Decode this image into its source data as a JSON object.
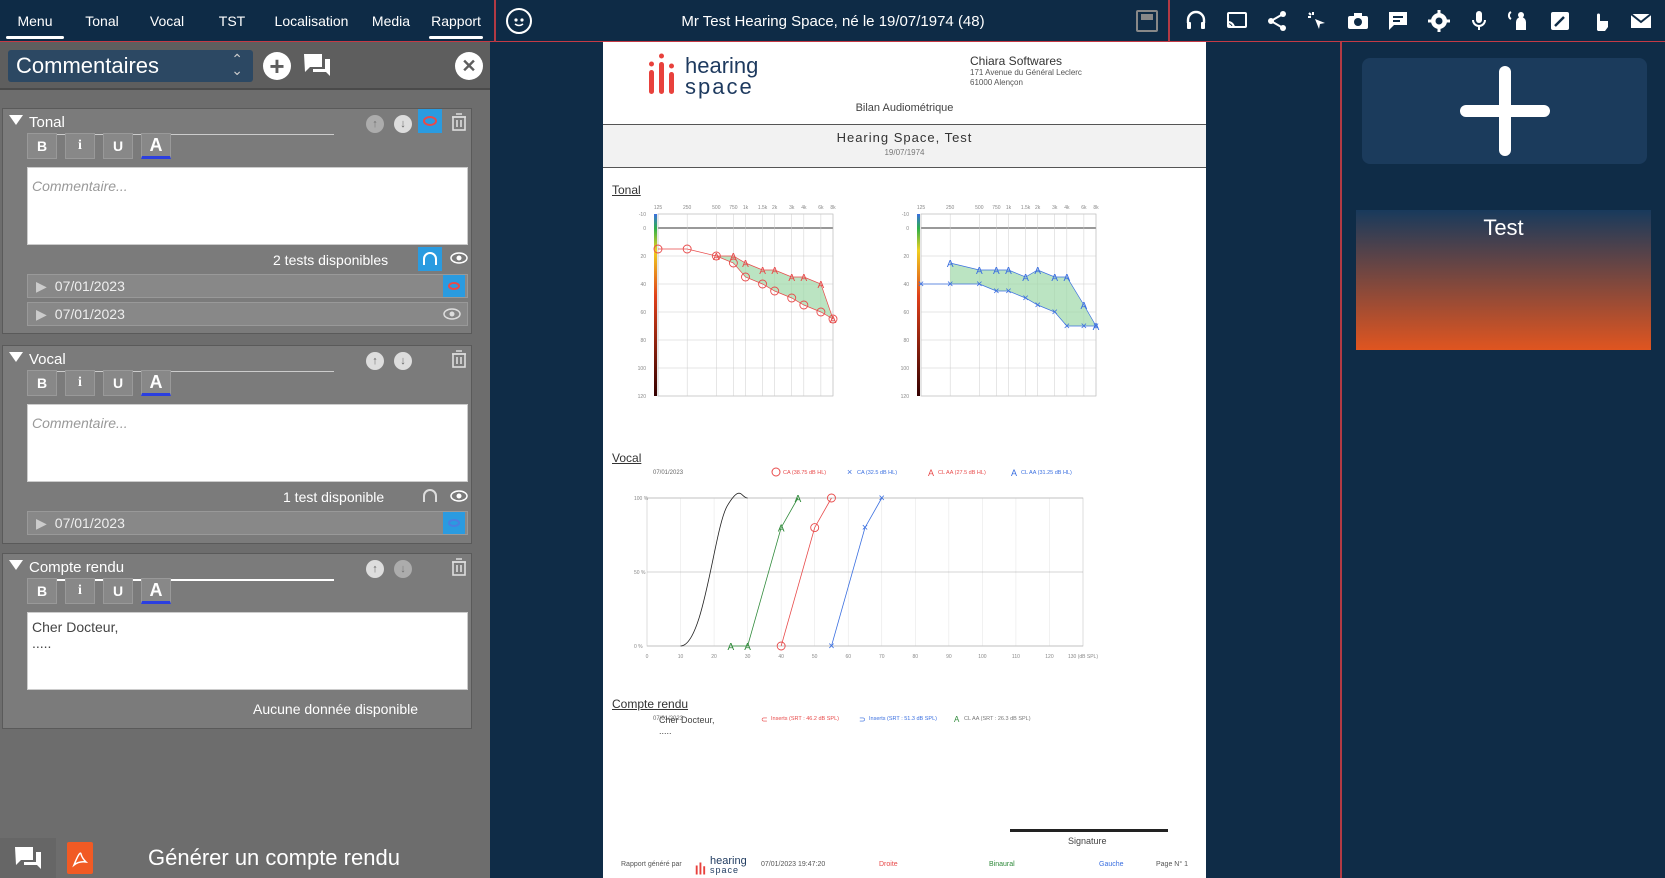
{
  "menu_tabs": [
    "Menu",
    "Tonal",
    "Vocal",
    "TST",
    "Localisation",
    "Media",
    "Rapport"
  ],
  "patient_title": "Mr Test Hearing Space, né le 19/07/1974 (48)",
  "left_panel": {
    "selector_label": "Commentaires",
    "sections": {
      "tonal": {
        "title": "Tonal",
        "placeholder": "Commentaire...",
        "tests_available": "2 tests disponibles",
        "dates": [
          "07/01/2023",
          "07/01/2023"
        ]
      },
      "vocal": {
        "title": "Vocal",
        "placeholder": "Commentaire...",
        "tests_available": "1 test disponible",
        "dates": [
          "07/01/2023"
        ]
      },
      "compte_rendu": {
        "title": "Compte rendu",
        "text_line1": "Cher Docteur,",
        "text_line2": ".....",
        "no_data": "Aucune donnée disponible"
      }
    },
    "format_buttons": {
      "bold": "B",
      "italic": "i",
      "underline": "U",
      "color": "A"
    },
    "generate_label": "Générer un compte rendu"
  },
  "report": {
    "brand_top": "hearing",
    "brand_bottom": "space",
    "company": "Chiara Softwares",
    "address1": "171 Avenue du Général Leclerc",
    "address2": "61000 Alençon",
    "report_title": "Bilan Audiométrique",
    "patient_name": "Hearing Space, Test",
    "patient_dob": "19/07/1974",
    "section_tonal": "Tonal",
    "section_vocal": "Vocal",
    "section_compte": "Compte rendu",
    "compte_line1": "Cher Docteur,",
    "compte_line2": ".....",
    "signature": "Signature",
    "footer_gen": "Rapport généré par",
    "footer_date": "07/01/2023 19:47:20",
    "footer_droite": "Droite",
    "footer_binaural": "Binaural",
    "footer_gauche": "Gauche",
    "footer_page": "Page N° 1",
    "tonal_legend_date": "07/01/2023",
    "tonal_legend": [
      "CA (38.75 dB HL)",
      "CA (32.5 dB HL)",
      "CL AA (27.5 dB HL)",
      "CL AA (31.25 dB HL)"
    ],
    "vocal_legend_date": "07/01/2023",
    "vocal_legend": [
      "Inserts (SRT : 46.2 dB SPL)",
      "Inserts (SRT : 51.3 dB SPL)",
      "CL AA (SRT : 26.3 dB SPL)"
    ]
  },
  "right_panel": {
    "add_label": "+",
    "card_label": "Test"
  },
  "colors": {
    "accent_red": "#c43a45",
    "right_ear": "#e84a4a",
    "left_ear": "#3a6fe0",
    "cl": "#2f8a3a",
    "card_top": "#183a5c",
    "card_bottom": "#e05520"
  },
  "chart_data": [
    {
      "type": "line",
      "title": "",
      "xlabel": "",
      "ylabel": "",
      "x": [
        125,
        250,
        500,
        750,
        1000,
        1500,
        2000,
        3000,
        4000,
        6000,
        8000
      ],
      "ylim": [
        -10,
        120
      ],
      "series": [
        {
          "name": "CA (38.75 dB HL)",
          "values": [
            15,
            15,
            20,
            25,
            35,
            40,
            45,
            50,
            55,
            60,
            65
          ]
        },
        {
          "name": "CL AA (27.5 dB HL)",
          "values": [
            null,
            null,
            20,
            20,
            25,
            30,
            30,
            35,
            35,
            40,
            65
          ]
        }
      ]
    },
    {
      "type": "line",
      "title": "",
      "xlabel": "",
      "ylabel": "",
      "x": [
        125,
        250,
        500,
        750,
        1000,
        1500,
        2000,
        3000,
        4000,
        6000,
        8000
      ],
      "ylim": [
        -10,
        120
      ],
      "series": [
        {
          "name": "CA (32.5 dB HL)",
          "values": [
            40,
            40,
            40,
            45,
            45,
            50,
            55,
            60,
            70,
            70,
            70
          ]
        },
        {
          "name": "CL AA (31.25 dB HL)",
          "values": [
            null,
            25,
            30,
            30,
            30,
            35,
            30,
            35,
            35,
            55,
            70
          ]
        }
      ]
    },
    {
      "type": "line",
      "title": "",
      "xlabel": "",
      "ylabel": "",
      "x": [
        0,
        10,
        20,
        30,
        40,
        50,
        60,
        70,
        80,
        90,
        100,
        110,
        120,
        130
      ],
      "xlim": [
        0,
        130
      ],
      "ylim": [
        0,
        100
      ],
      "series": [
        {
          "name": "Inserts (SRT : 46.2 dB SPL)",
          "points": [
            [
              40,
              0
            ],
            [
              50,
              80
            ],
            [
              55,
              100
            ]
          ]
        },
        {
          "name": "Inserts (SRT : 51.3 dB SPL)",
          "points": [
            [
              55,
              0
            ],
            [
              65,
              80
            ],
            [
              70,
              100
            ]
          ]
        },
        {
          "name": "CL AA (SRT : 26.3 dB SPL)",
          "points": [
            [
              25,
              0
            ],
            [
              30,
              0
            ],
            [
              40,
              80
            ],
            [
              45,
              100
            ]
          ]
        }
      ]
    }
  ]
}
